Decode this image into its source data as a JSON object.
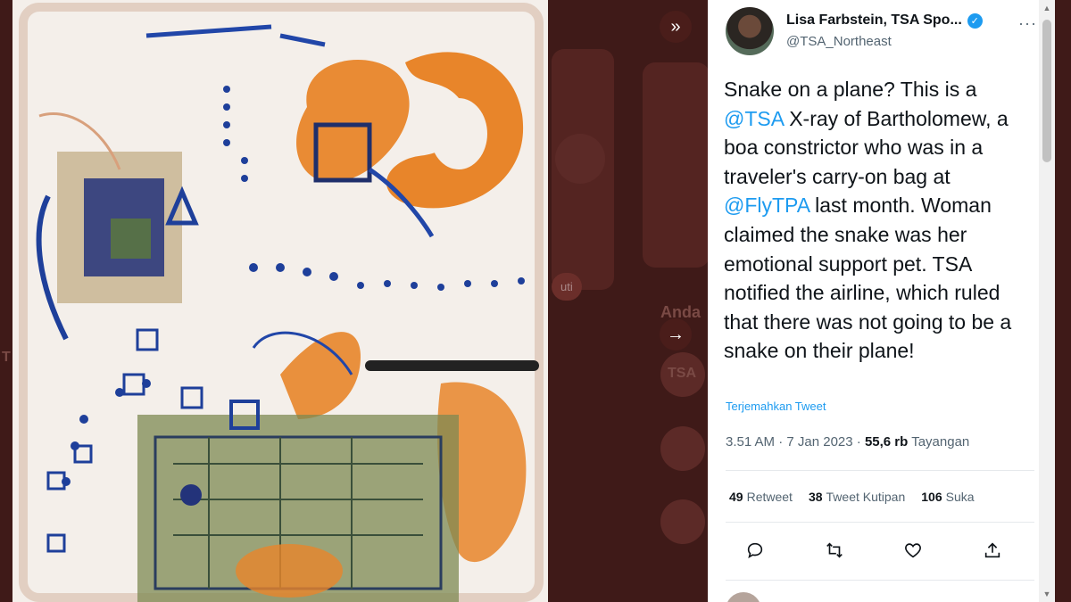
{
  "background_page": {
    "follow_button_label": "uti",
    "section_heading": "Anda",
    "logo_text": "TSA",
    "side_text": "T"
  },
  "media": {
    "next_button_icon": "chevrons-right-icon",
    "expand_button_icon": "arrow-right-icon"
  },
  "tweet": {
    "author_name": "Lisa Farbstein, TSA Spo...",
    "author_handle": "@TSA_Northeast",
    "more_label": "···",
    "text_parts": {
      "p1": "Snake on a plane? This is a ",
      "mention1": "@TSA",
      "p2": " X-ray of Bartholomew, a boa constrictor who was in a traveler's carry-on bag at ",
      "mention2": "@FlyTPA",
      "p3": " last month. Woman claimed the snake was her emotional support pet. TSA notified the airline, which ruled that there was not going to be a snake on their plane!"
    },
    "translate_label": "Terjemahkan Tweet",
    "time": "3.51 AM · 7 Jan 2023 · ",
    "views_count": "55,6 rb",
    "views_label": "Tayangan",
    "stats": {
      "retweets_count": "49",
      "retweets_label": "Retweet",
      "quotes_count": "38",
      "quotes_label": "Tweet Kutipan",
      "likes_count": "106",
      "likes_label": "Suka"
    }
  },
  "colors": {
    "accent": "#1d9bf0",
    "backdrop": "#4a1f1c"
  }
}
